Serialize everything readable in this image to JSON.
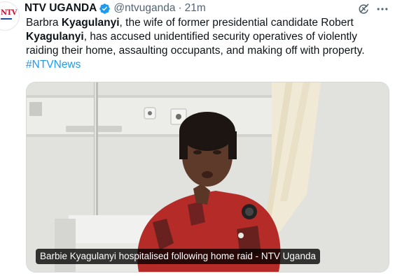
{
  "tweet": {
    "display_name": "NTV UGANDA",
    "handle": "@ntvuganda",
    "separator": "·",
    "time": "21m",
    "avatar_text": "NTV",
    "text_part1": "Barbra ",
    "text_bold1": "Kyagulanyi",
    "text_part2": ", the wife of former presidential candidate Robert ",
    "text_bold2": "Kyagulanyi",
    "text_part3": ", has accused unidentified security operatives of violently raiding their home, assaulting occupants, and making off with property.",
    "hashtag": "#NTVNews",
    "media_caption": "Barbie Kyagulanyi hospitalised following home raid - NTV Uganda"
  },
  "icons": {
    "verified": "verified-badge-icon",
    "grok": "grok-icon",
    "more": "more-options-icon"
  },
  "colors": {
    "link": "#1d9bf0",
    "verified": "#1d9bf0",
    "secondary_text": "#536471",
    "brand_red": "#c8102e"
  }
}
